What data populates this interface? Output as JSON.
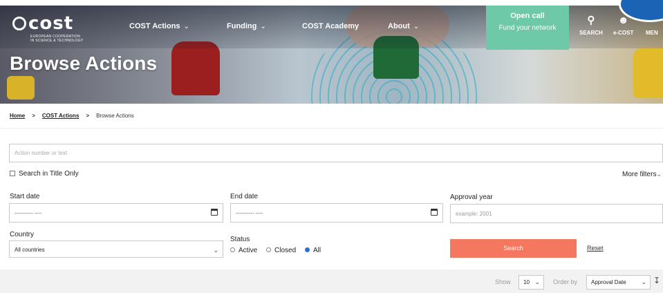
{
  "header": {
    "logo_text": "cost",
    "logo_tagline_1": "EUROPEAN COOPERATION",
    "logo_tagline_2": "IN SCIENCE & TECHNOLOGY",
    "nav": [
      {
        "label": "COST Actions",
        "has_dropdown": true
      },
      {
        "label": "Funding",
        "has_dropdown": true
      },
      {
        "label": "COST Academy",
        "has_dropdown": false
      },
      {
        "label": "About",
        "has_dropdown": true
      }
    ],
    "open_call": {
      "line1": "Open call",
      "line2": "Fund your network"
    },
    "tools": [
      {
        "icon": "search-icon",
        "label": "SEARCH"
      },
      {
        "icon": "user-icon",
        "label": "e-COST"
      },
      {
        "icon": "menu-icon",
        "label": "MEN"
      }
    ],
    "page_title": "Browse Actions"
  },
  "breadcrumb": {
    "items": [
      "Home",
      "COST Actions",
      "Browse Actions"
    ]
  },
  "filters": {
    "search_placeholder": "Action number or text",
    "title_only_label": "Search in Title Only",
    "more_filters_label": "More filters",
    "start_date_label": "Start date",
    "start_date_value": "---------- ----",
    "end_date_label": "End date",
    "end_date_value": "---------- ----",
    "approval_year_label": "Approval year",
    "approval_year_placeholder": "example: 2001",
    "country_label": "Country",
    "country_value": "All countries",
    "status_label": "Status",
    "status_options": [
      "Active",
      "Closed",
      "All"
    ],
    "status_selected": "All",
    "search_button": "Search",
    "reset_link": "Reset"
  },
  "results": {
    "show_label": "Show",
    "show_value": "10",
    "order_label": "Order by",
    "order_value": "Approval Date"
  },
  "colors": {
    "accent": "#f4775f",
    "open_call": "#6ec9a8",
    "radio_on": "#2d6fd6",
    "blob": "#1b63b5"
  }
}
